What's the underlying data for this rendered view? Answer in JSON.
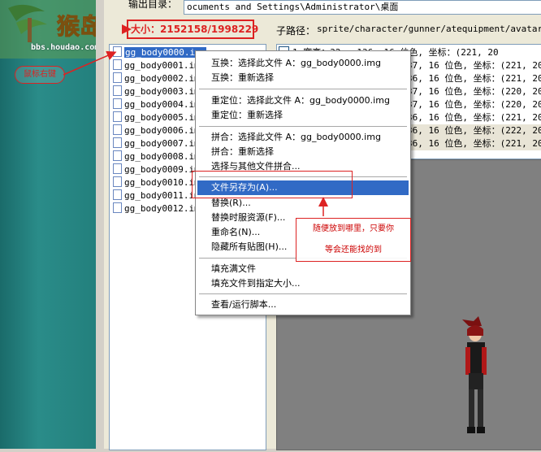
{
  "logo": {
    "site": "bbs.houdao.com",
    "glyph": "猴岛"
  },
  "annotations": {
    "size": "大小：2152158/1998229",
    "mouse": "鼠标右键",
    "note_line1": "随便放到哪里，只要你",
    "note_line2": "等会还能找的到"
  },
  "output": {
    "label": "输出目录：",
    "path": "ocuments and Settings\\Administrator\\桌面"
  },
  "subpath": {
    "label": "子路径：",
    "path": "sprite/character/gunner/atequipment/avatar/skin"
  },
  "files": [
    "gg_body0000.img",
    "gg_body0001.img",
    "gg_body0002.img",
    "gg_body0003.img",
    "gg_body0004.img",
    "gg_body0005.img",
    "gg_body0006.img",
    "gg_body0007.img",
    "gg_body0008.img",
    "gg_body0009.img",
    "gg_body0010.img",
    "gg_body0011.img",
    "gg_body0012.img"
  ],
  "frames": [
    "1   宽高：32 x 136, 16 位色, 坐标：(221, 20",
    "37, 16 位色, 坐标：(221, 20",
    "36, 16 位色, 坐标：(221, 20",
    "37, 16 位色, 坐标：(220, 20",
    "37, 16 位色, 坐标：(220, 20",
    "36, 16 位色, 坐标：(221, 20",
    "36, 16 位色, 坐标：(222, 20",
    "36, 16 位色, 坐标：(221, 20"
  ],
  "menu": {
    "swap_select": "互换：选择此文件 A：gg_body0000.img",
    "swap_reselect": "互换：重新选择",
    "relocate_select": "重定位：选择此文件 A：gg_body0000.img",
    "relocate_reselect": "重定位：重新选择",
    "merge_select": "拼合：选择此文件 A：gg_body0000.img",
    "merge_reselect": "拼合：重新选择",
    "merge_other": "选择与其他文件拼合...",
    "save_as": "文件另存为(A)...",
    "replace": "替换(R)...",
    "replace_costume": "替换时服资源(F)...",
    "rename": "重命名(N)...",
    "hide_all": "隐藏所有贴图(H)...",
    "fill_full": "填充满文件",
    "fill_size": "填充文件到指定大小...",
    "run_script": "查看/运行脚本..."
  }
}
